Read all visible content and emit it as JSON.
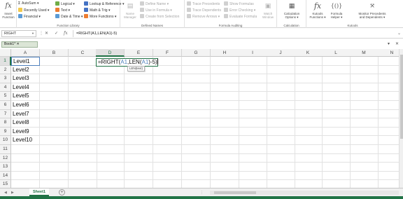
{
  "ribbon": {
    "insert_function": {
      "line1": "Insert",
      "line2": "Function",
      "icon": "fx-icon"
    },
    "function_library": {
      "label": "Function Library",
      "autosum": "AutoSum",
      "recently_used": "Recently Used",
      "financial": "Financial",
      "logical": "Logical",
      "text": "Text",
      "date_time": "Date & Time",
      "lookup": "Lookup & Reference",
      "math": "Math & Trig",
      "more": "More Functions"
    },
    "defined_names": {
      "label": "Defined Names",
      "name_manager_l1": "Name",
      "name_manager_l2": "Manager",
      "define_name": "Define Name",
      "use_in_formula": "Use in Formula",
      "create_from_selection": "Create from Selection"
    },
    "formula_auditing": {
      "label": "Formula Auditing",
      "trace_precedents": "Trace Precedents",
      "trace_dependents": "Trace Dependents",
      "remove_arrows": "Remove Arrows",
      "show_formulas": "Show Formulas",
      "error_checking": "Error Checking",
      "evaluate_formula": "Evaluate Formula",
      "watch_l1": "Watch",
      "watch_l2": "Window"
    },
    "calculation": {
      "label": "Calculation",
      "options_l1": "Calculation",
      "options_l2": "Options"
    },
    "kutools": {
      "label": "Kutools",
      "functions_l1": "Kutools",
      "functions_l2": "Functions",
      "helper_l1": "Formula",
      "helper_l2": "Helper",
      "monitor_l1": "Monitor Precedents",
      "monitor_l2": "and Dependents"
    }
  },
  "formula_bar": {
    "name_box": "RIGHT",
    "cancel_glyph": "✕",
    "enter_glyph": "✓",
    "fx_glyph": "fx",
    "formula": "=RIGHT(A1,LEN(A1)-5)"
  },
  "workbook_tab": {
    "name": "Book1",
    "marker": "*"
  },
  "columns": [
    "A",
    "B",
    "C",
    "D",
    "E",
    "F",
    "G",
    "H",
    "I",
    "J",
    "K",
    "L",
    "M",
    "N"
  ],
  "active_column": "D",
  "rows": [
    "1",
    "2",
    "3",
    "4",
    "5",
    "6",
    "7",
    "8",
    "9",
    "10",
    "11",
    "12",
    "13",
    "14",
    "15",
    "16"
  ],
  "column_a_values": [
    "Level1",
    "Level2",
    "Level3",
    "Level4",
    "Level5",
    "Level6",
    "Level7",
    "Level8",
    "Level9",
    "Level10"
  ],
  "edit_cell": {
    "part1": "=RIGHT(",
    "ref1": "A1",
    "part2": ",LEN(",
    "ref2": "A1",
    "part3": ")-5)",
    "tooltip": "LEN(text)"
  },
  "sheets": {
    "active": "Sheet1",
    "add_glyph": "+"
  },
  "colors": {
    "accent": "#217346",
    "reference": "#4f81bd"
  }
}
